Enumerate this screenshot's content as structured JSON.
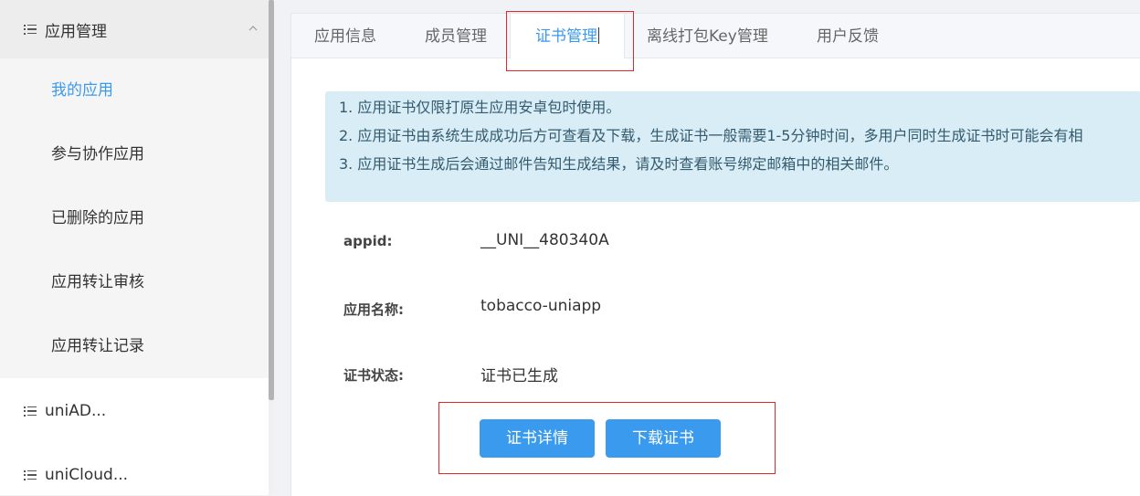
{
  "sidebar": {
    "group_title": "应用管理",
    "sub_items": [
      {
        "label": "我的应用",
        "active": true
      },
      {
        "label": "参与协作应用",
        "active": false
      },
      {
        "label": "已删除的应用",
        "active": false
      },
      {
        "label": "应用转让审核",
        "active": false
      },
      {
        "label": "应用转让记录",
        "active": false
      }
    ],
    "other_groups": [
      {
        "label": "uniAD..."
      },
      {
        "label": "uniCloud..."
      }
    ]
  },
  "tabs": [
    {
      "label": "应用信息"
    },
    {
      "label": "成员管理"
    },
    {
      "label": "证书管理",
      "active": true
    },
    {
      "label": "离线打包Key管理"
    },
    {
      "label": "用户反馈"
    }
  ],
  "notice": {
    "lines": [
      "1. 应用证书仅限打原生应用安卓包时使用。",
      "2. 应用证书由系统生成成功后方可查看及下载，生成证书一般需要1-5分钟时间，多用户同时生成证书时可能会有相",
      "3. 应用证书生成后会通过邮件告知生成结果，请及时查看账号绑定邮箱中的相关邮件。"
    ]
  },
  "fields": {
    "appid_label": "appid:",
    "appid_value": "__UNI__480340A",
    "name_label": "应用名称:",
    "name_value": "tobacco-uniapp",
    "status_label": "证书状态:",
    "status_value": "证书已生成"
  },
  "buttons": {
    "details": "证书详情",
    "download": "下载证书"
  },
  "colors": {
    "accent": "#3a9aee",
    "notice_bg": "#d9edf7",
    "highlight_border": "#e02828"
  }
}
